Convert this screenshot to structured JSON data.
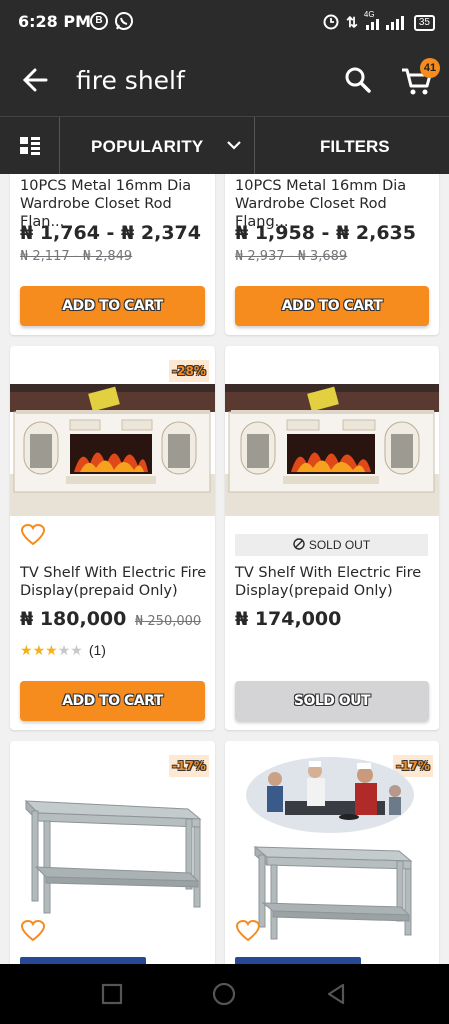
{
  "status_bar": {
    "time": "6:28 PM",
    "icon_b": "B",
    "network": "4G",
    "battery": "35"
  },
  "header": {
    "search_query": "fire shelf",
    "cart_count": "41"
  },
  "sort_bar": {
    "sort_label": "POPULARITY",
    "filters_label": "FILTERS"
  },
  "products": [
    {
      "name": "10PCS Metal 16mm Dia Wardrobe Closet Rod Flan...",
      "price": "₦ 1,764 - ₦ 2,374",
      "old_price": "₦ 2,117 - ₦ 2,849",
      "button": "ADD TO CART"
    },
    {
      "name": "10PCS Metal 16mm Dia Wardrobe Closet Rod Flang...",
      "price": "₦ 1,958 - ₦ 2,635",
      "old_price": "₦ 2,937 - ₦ 3,689",
      "button": "ADD TO CART"
    },
    {
      "discount": "-28%",
      "name": "TV Shelf With Electric Fire Display(prepaid Only)",
      "price": "₦ 180,000",
      "old_price": "₦ 250,000",
      "rating": 3,
      "rating_count": "(1)",
      "button": "ADD TO CART"
    },
    {
      "sold_out_badge": "SOLD OUT",
      "name": "TV Shelf With Electric Fire Display(prepaid Only)",
      "price": "₦ 174,000",
      "button": "SOLD OUT"
    },
    {
      "discount": "-17%"
    },
    {
      "discount": "-17%"
    }
  ],
  "colors": {
    "header_bg": "#2b2b2b",
    "accent": "#f68b1e",
    "page_bg": "#f1f1f2",
    "sold_out_button": "#d4d4d6"
  }
}
